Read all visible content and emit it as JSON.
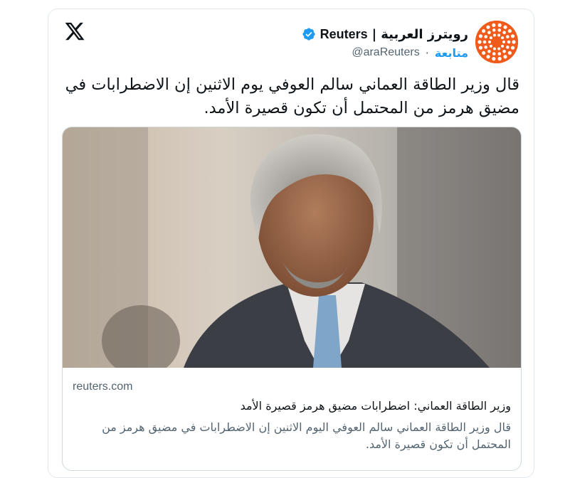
{
  "header": {
    "display_name_arabic": "رويترز العربية",
    "separator": "|",
    "display_name_latin": "Reuters",
    "handle": "@araReuters",
    "dot": "·",
    "follow_label": "متابعة",
    "avatar_icon": "reuters-logo",
    "verified_icon": "verified-badge-icon",
    "platform_icon": "x-logo-icon"
  },
  "tweet": {
    "text": "قال وزير الطاقة العماني سالم العوفي يوم الاثنين إن الاضطرابات في مضيق هرمز من المحتمل أن تكون قصيرة الأمد."
  },
  "link_card": {
    "domain": "reuters.com",
    "headline": "وزير الطاقة العماني:  اضطرابات مضيق هرمز قصيرة الأمد",
    "description": "قال وزير الطاقة العماني سالم العوفي اليوم الاثنين إن الاضطرابات في مضيق هرمز من المحتمل أن تكون قصيرة الأمد."
  },
  "colors": {
    "brand_orange": "#f05a1a",
    "link_blue": "#1d9bf0",
    "text_primary": "#0f1419",
    "text_secondary": "#536471",
    "border": "#cfd9de"
  }
}
